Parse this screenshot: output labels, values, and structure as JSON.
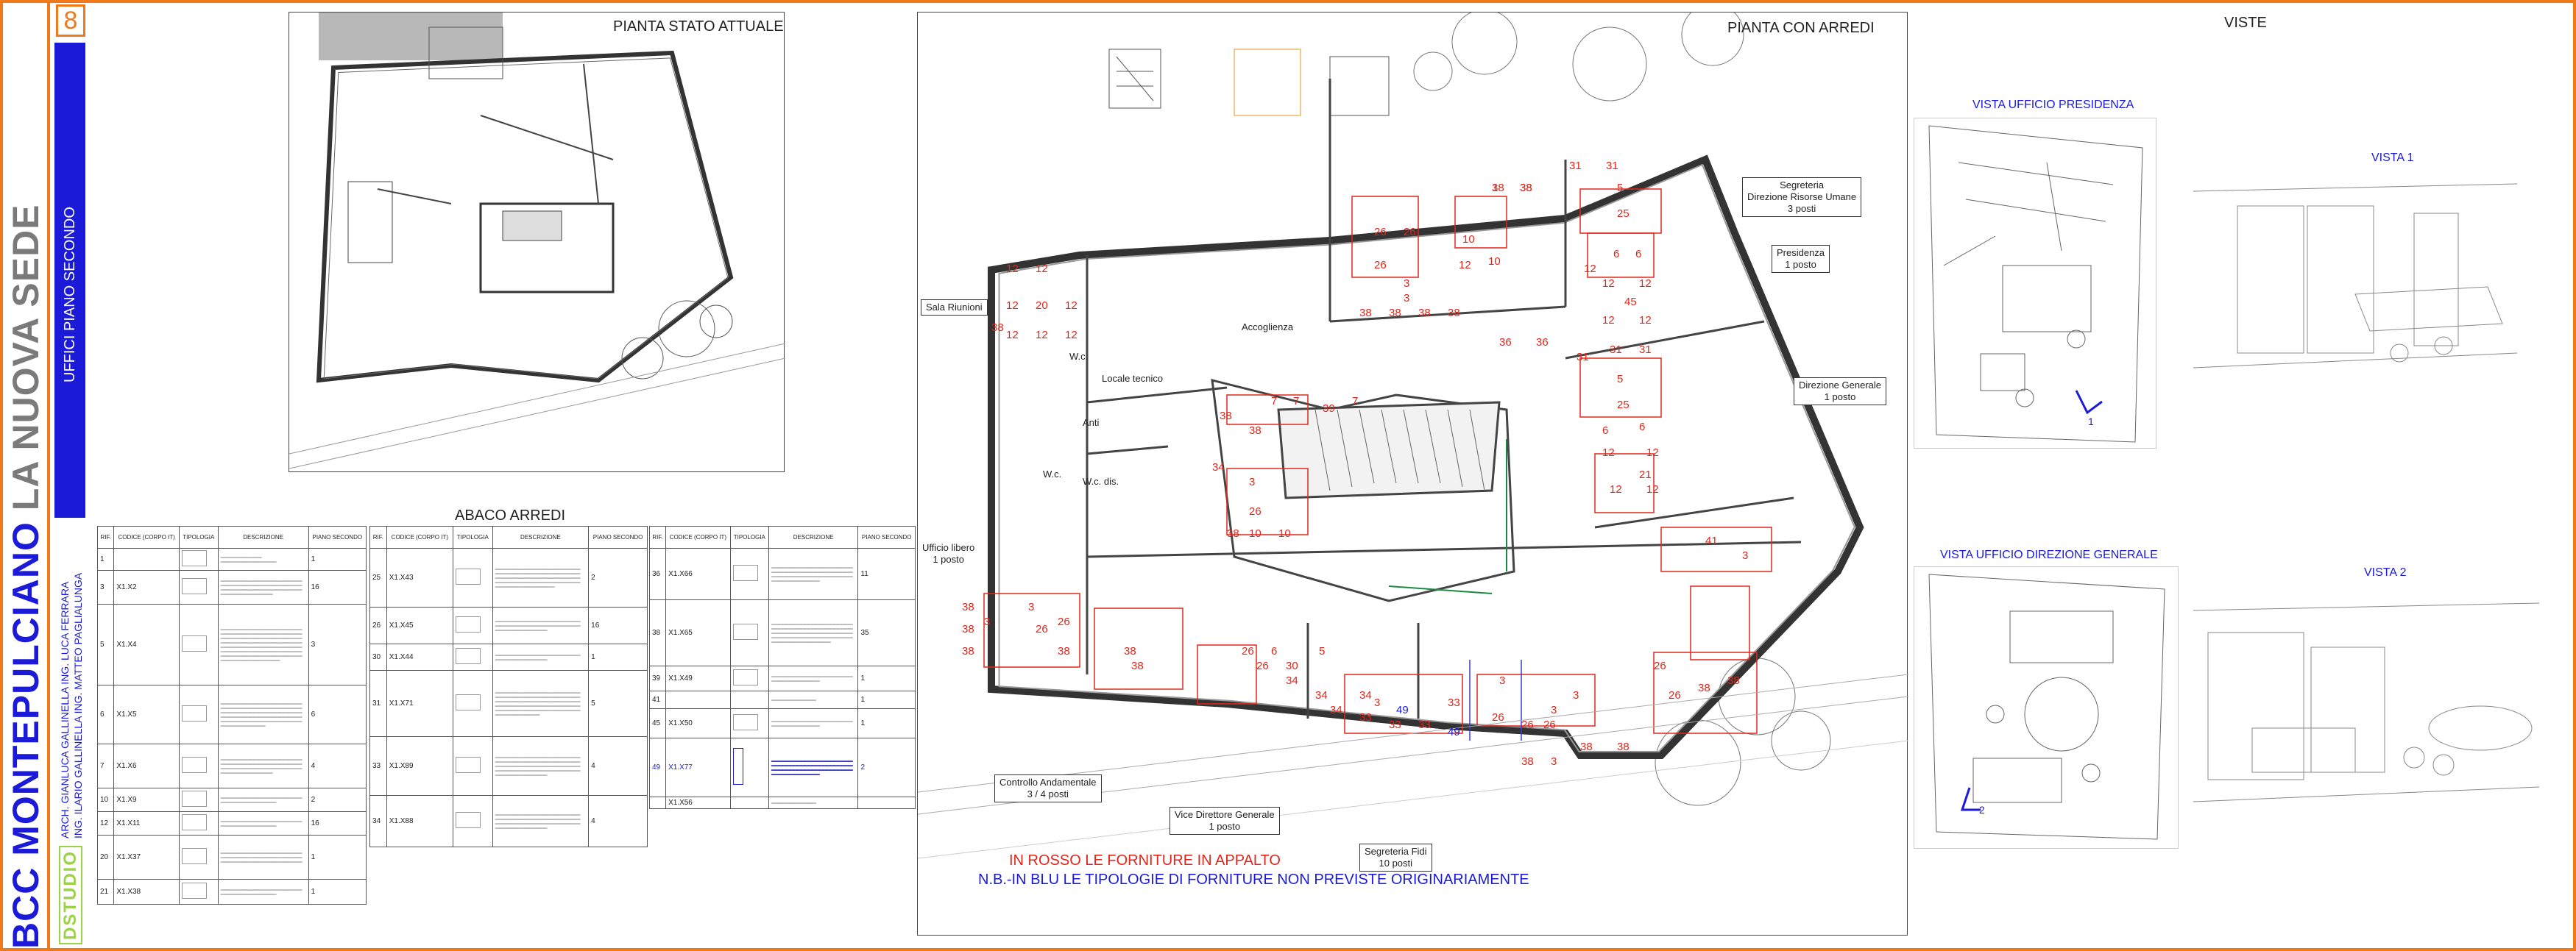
{
  "sidebar": {
    "title_bcc": "BCC",
    "title_montepulciano": "MONTEPULCIANO",
    "title_nuova_sede": "LA NUOVA SEDE",
    "page_number": "8",
    "section": "UFFICI PIANO SECONDO",
    "authors_line1": "ARCH. GIANLUCA GALLINELLA  ING. LUCA FERRARA",
    "authors_line2": "ING. ILARIO GALLINELLA  ING. MATTEO PAGLIALUNGA",
    "logo_text": "DSTUDIO"
  },
  "panels": {
    "stato_attuale": "PIANTA STATO ATTUALE",
    "con_arredi": "PIANTA CON ARREDI",
    "viste": "VISTE",
    "abaco": "ABACO ARREDI"
  },
  "rooms": {
    "sala_riunioni": "Sala Riunioni",
    "wc1": "W.c.",
    "locale_tecnico": "Locale tecnico",
    "accoglienza": "Accoglienza",
    "anti": "Anti",
    "wc2": "W.c.",
    "wc_dis": "W.c. dis.",
    "ufficio_libero": "Ufficio libero\n1 posto",
    "segreteria_risorse": "Segreteria\nDirezione Risorse Umane\n3 posti",
    "presidenza": "Presidenza\n1 posto",
    "direzione_generale": "Direzione Generale\n1 posto",
    "controllo_andamentale": "Controllo Andamentale\n3 / 4 posti",
    "vice_direttore": "Vice Direttore Generale\n1 posto",
    "segreteria_fidi": "Segreteria Fidi\n10 posti"
  },
  "notes": {
    "red": "IN ROSSO LE FORNITURE IN APPALTO",
    "blue": "N.B.-IN BLU LE TIPOLOGIE DI FORNITURE NON PREVISTE ORIGINARIAMENTE"
  },
  "views": {
    "presidenza": "VISTA UFFICIO PRESIDENZA",
    "vista1": "VISTA 1",
    "direzione": "VISTA UFFICIO DIREZIONE GENERALE",
    "vista2": "VISTA 2",
    "marker1": "1",
    "marker2": "2"
  },
  "abaco_headers": [
    "RIF.",
    "CODICE (CORPO IT)",
    "TIPOLOGIA",
    "DESCRIZIONE",
    "PIANO SECONDO"
  ],
  "abaco_col1": [
    {
      "rif": "1",
      "code": "",
      "qty": "1"
    },
    {
      "rif": "3",
      "code": "X1.X2",
      "qty": "16"
    },
    {
      "rif": "5",
      "code": "X1.X4",
      "qty": "3"
    },
    {
      "rif": "6",
      "code": "X1.X5",
      "qty": "6"
    },
    {
      "rif": "7",
      "code": "X1.X6",
      "qty": "4"
    },
    {
      "rif": "10",
      "code": "X1.X9",
      "qty": "2"
    },
    {
      "rif": "12",
      "code": "X1.X11",
      "qty": "16"
    },
    {
      "rif": "20",
      "code": "X1.X37",
      "qty": "1"
    },
    {
      "rif": "21",
      "code": "X1.X38",
      "qty": "1"
    }
  ],
  "abaco_col2": [
    {
      "rif": "25",
      "code": "X1.X43",
      "qty": "2"
    },
    {
      "rif": "26",
      "code": "X1.X45",
      "qty": "16"
    },
    {
      "rif": "30",
      "code": "X1.X44",
      "qty": "1"
    },
    {
      "rif": "31",
      "code": "X1.X71",
      "qty": "5"
    },
    {
      "rif": "33",
      "code": "X1.X89",
      "qty": "4"
    },
    {
      "rif": "34",
      "code": "X1.X88",
      "qty": "4"
    }
  ],
  "abaco_col3": [
    {
      "rif": "36",
      "code": "X1.X66",
      "qty": "11"
    },
    {
      "rif": "38",
      "code": "X1.X65",
      "qty": "35"
    },
    {
      "rif": "39",
      "code": "X1.X49",
      "qty": "1"
    },
    {
      "rif": "41",
      "code": "",
      "qty": "1"
    },
    {
      "rif": "45",
      "code": "X1.X50",
      "qty": "1"
    },
    {
      "rif": "49",
      "code": "X1.X77",
      "qty": "2"
    },
    {
      "rif": "",
      "code": "X1.X56",
      "qty": ""
    }
  ],
  "plan_numbers": [
    "1",
    "38",
    "31",
    "31",
    "5",
    "25",
    "26",
    "26",
    "26",
    "10",
    "10",
    "12",
    "12",
    "6",
    "6",
    "3",
    "38",
    "38",
    "38",
    "38",
    "12",
    "12",
    "45",
    "12",
    "12",
    "3",
    "36",
    "36",
    "31",
    "31",
    "31",
    "5",
    "25",
    "6",
    "6",
    "12",
    "12",
    "21",
    "12",
    "12",
    "12",
    "12",
    "12",
    "20",
    "12",
    "12",
    "12",
    "12",
    "38",
    "7",
    "7",
    "39",
    "7",
    "38",
    "38",
    "34",
    "3",
    "26",
    "10",
    "10",
    "38",
    "41",
    "3",
    "3",
    "26",
    "26",
    "38",
    "38",
    "38",
    "38",
    "38",
    "38",
    "3",
    "26",
    "26",
    "6",
    "30",
    "5",
    "34",
    "34",
    "34",
    "34",
    "33",
    "33",
    "33",
    "33",
    "49",
    "49",
    "26",
    "26",
    "26",
    "3",
    "3",
    "3",
    "3",
    "38",
    "38",
    "38",
    "3",
    "26",
    "26",
    "38",
    "38",
    "38",
    "38"
  ]
}
